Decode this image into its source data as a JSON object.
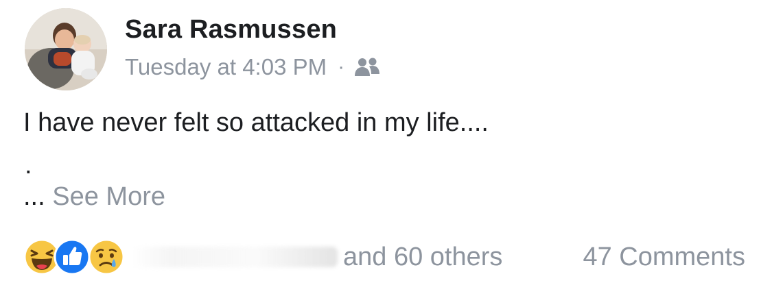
{
  "post": {
    "author_name": "Sara Rasmussen",
    "timestamp": "Tuesday at 4:03 PM",
    "separator": "·",
    "audience_icon": "friends-icon",
    "body": "I have never felt so attacked in my life....",
    "body_dot": ".",
    "ellipsis": "...",
    "see_more": "See More"
  },
  "footer": {
    "reaction_icons": [
      "haha-icon",
      "like-icon",
      "sad-icon"
    ],
    "others_text": "and 60 others",
    "comments_text": "47 Comments"
  },
  "colors": {
    "text_primary": "#1c1e21",
    "text_secondary": "#8d949e",
    "like_blue": "#1877f2",
    "emoji_yellow": "#f7c644"
  }
}
